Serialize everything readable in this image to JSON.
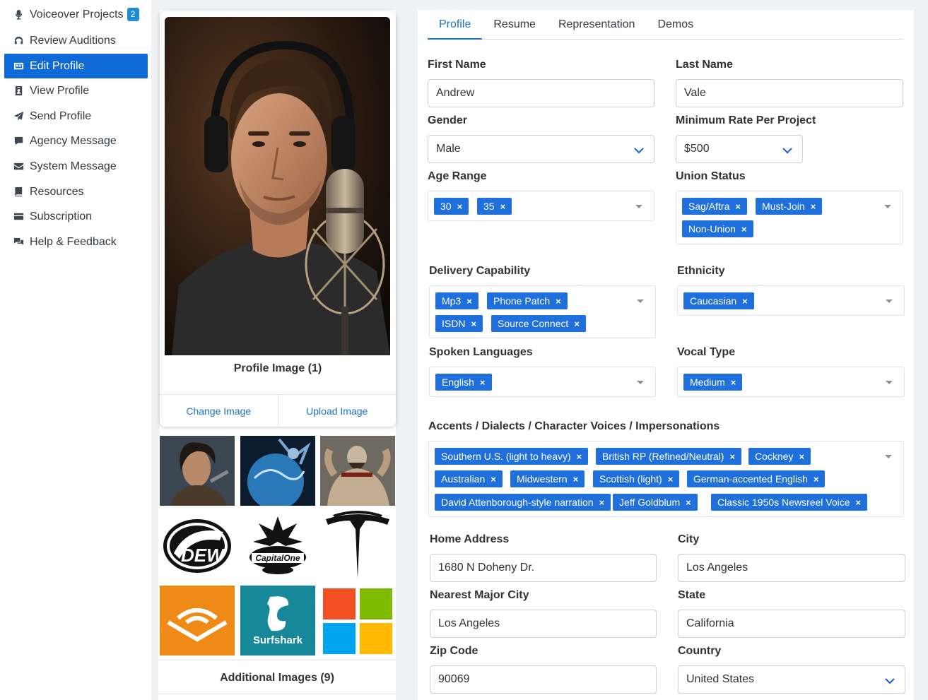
{
  "sidebar": {
    "items": [
      {
        "label": "Voiceover Projects",
        "icon": "microphone-icon",
        "badge": "2"
      },
      {
        "label": "Review Auditions",
        "icon": "headphones-icon"
      },
      {
        "label": "Edit Profile",
        "icon": "id-card-icon",
        "active": true
      },
      {
        "label": "View Profile",
        "icon": "id-badge-icon"
      },
      {
        "label": "Send Profile",
        "icon": "paper-plane-icon"
      },
      {
        "label": "Agency Message",
        "icon": "comment-icon"
      },
      {
        "label": "System Message",
        "icon": "envelope-icon"
      },
      {
        "label": "Resources",
        "icon": "book-icon"
      },
      {
        "label": "Subscription",
        "icon": "credit-card-icon"
      },
      {
        "label": "Help & Feedback",
        "icon": "comments-icon"
      }
    ]
  },
  "image_panel": {
    "profile_caption": "Profile Image (1)",
    "change_image": "Change Image",
    "upload_image": "Upload Image",
    "additional_caption": "Additional Images (9)",
    "thumb_logo_text": {
      "surfshark": "Surfshark"
    }
  },
  "tabs": [
    "Profile",
    "Resume",
    "Representation",
    "Demos"
  ],
  "form": {
    "first_name_label": "First Name",
    "first_name": "Andrew",
    "last_name_label": "Last Name",
    "last_name": "Vale",
    "gender_label": "Gender",
    "gender": "Male",
    "min_rate_label": "Minimum Rate Per Project",
    "min_rate": "$500",
    "age_range_label": "Age Range",
    "age_range": [
      "30",
      "35"
    ],
    "union_label": "Union Status",
    "union": [
      "Sag/Aftra",
      "Must-Join",
      "Non-Union"
    ],
    "delivery_label": "Delivery Capability",
    "delivery": [
      "Mp3",
      "Phone Patch",
      "ISDN",
      "Source Connect"
    ],
    "ethnicity_label": "Ethnicity",
    "ethnicity": [
      "Caucasian"
    ],
    "languages_label": "Spoken Languages",
    "languages": [
      "English"
    ],
    "vocal_label": "Vocal Type",
    "vocal": [
      "Medium"
    ],
    "accents_label": "Accents / Dialects / Character Voices / Impersonations",
    "accents": [
      "Southern U.S. (light to heavy)",
      "British RP (Refined/Neutral)",
      "Cockney",
      "Australian",
      "Midwestern",
      "Scottish (light)",
      "German-accented English",
      "David Attenborough-style narration",
      "Jeff Goldblum",
      "Classic 1950s Newsreel Voice"
    ],
    "home_address_label": "Home Address",
    "home_address": "1680 N Doheny Dr.",
    "city_label": "City",
    "city": "Los Angeles",
    "nearest_city_label": "Nearest Major City",
    "nearest_city": "Los Angeles",
    "state_label": "State",
    "state": "California",
    "zip_label": "Zip Code",
    "zip": "90069",
    "country_label": "Country",
    "country": "United States"
  },
  "colors": {
    "accent": "#0d6ad6",
    "tag": "#1f6fdc",
    "link": "#1a73c8"
  }
}
